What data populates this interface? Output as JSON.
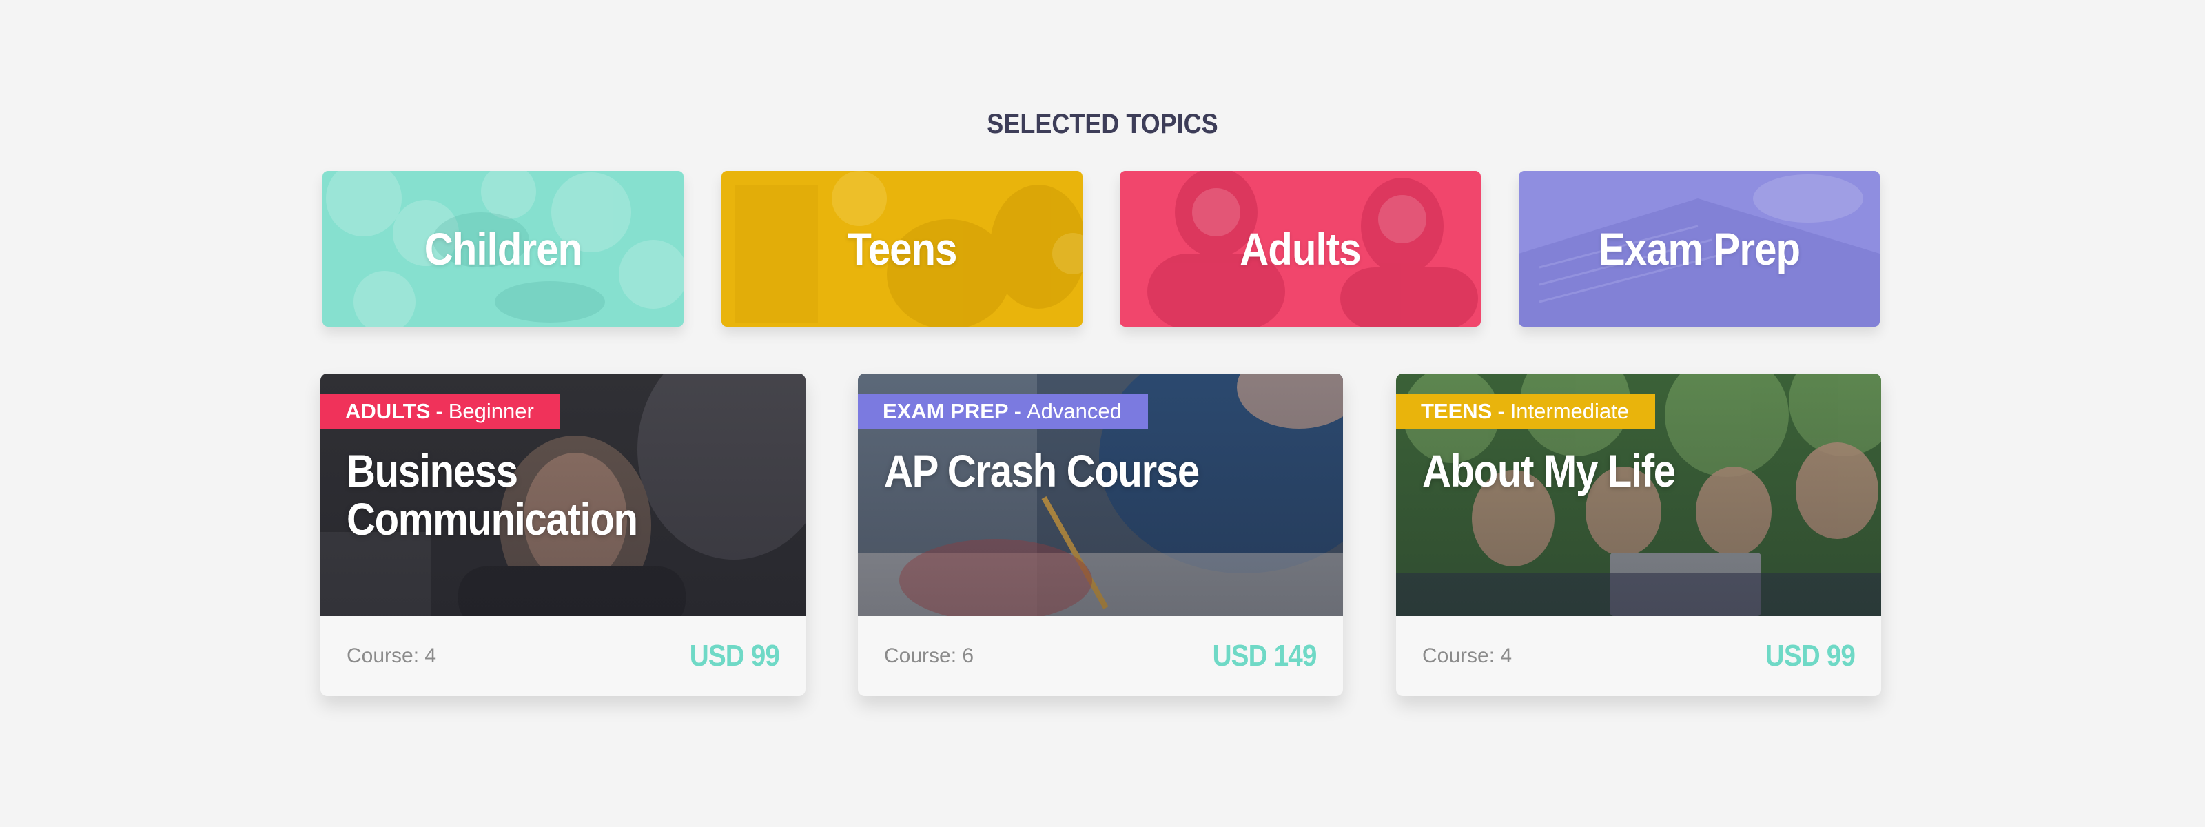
{
  "section": {
    "title": "SELECTED TOPICS"
  },
  "topics": [
    {
      "label": "Children",
      "color": "#86e0cf",
      "icon": "children-photo"
    },
    {
      "label": "Teens",
      "color": "#e9b40c",
      "icon": "teens-photo"
    },
    {
      "label": "Adults",
      "color": "#f1466c",
      "icon": "adults-photo"
    },
    {
      "label": "Exam Prep",
      "color": "#8f8ee0",
      "icon": "exam-prep-photo"
    }
  ],
  "courses": [
    {
      "category": "ADULTS",
      "separator": "-",
      "level": "Beginner",
      "title_lines": [
        "Business",
        "Communication"
      ],
      "count": "Course: 4",
      "price": "USD 99",
      "badge_color": "#f0325a"
    },
    {
      "category": "EXAM PREP",
      "separator": "-",
      "level": "Advanced",
      "title_lines": [
        "AP Crash Course"
      ],
      "count": "Course: 6",
      "price": "USD 149",
      "badge_color": "#7b7ae0"
    },
    {
      "category": "TEENS",
      "separator": "-",
      "level": "Intermediate",
      "title_lines": [
        "About My Life"
      ],
      "count": "Course: 4",
      "price": "USD 99",
      "badge_color": "#e9b40c"
    }
  ],
  "colors": {
    "background": "#f4f4f4",
    "title": "#3d3d58",
    "price": "#6fd9c6",
    "muted_text": "#8b8b8b"
  }
}
